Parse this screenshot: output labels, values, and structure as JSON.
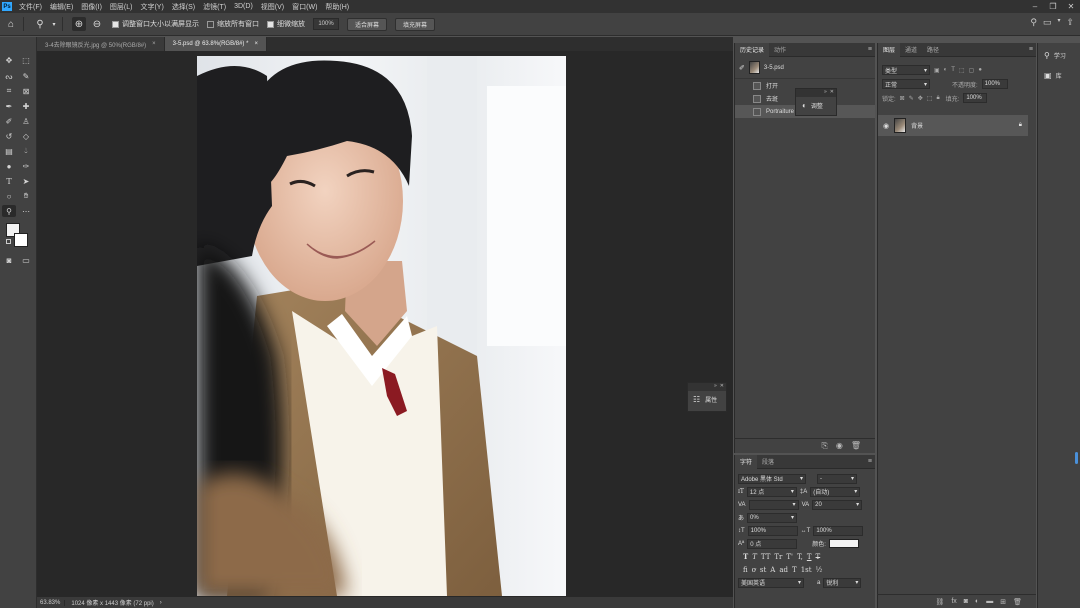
{
  "menubar": {
    "logo": "Ps",
    "items": [
      "文件(F)",
      "编辑(E)",
      "图像(I)",
      "图层(L)",
      "文字(Y)",
      "选择(S)",
      "滤镜(T)",
      "3D(D)",
      "视图(V)",
      "窗口(W)",
      "帮助(H)"
    ]
  },
  "options": {
    "resize_windows_label": "调整窗口大小以满屏显示",
    "zoom_all_label": "缩放所有窗口",
    "scrubby_label": "细微缩放",
    "zoom_value": "100%",
    "fit_screen_label": "适合屏幕",
    "fill_screen_label": "填充屏幕"
  },
  "tabs": [
    {
      "label": "3-4去除眼镜反光.jpg @ 50%(RGB/8#)",
      "close": "×"
    },
    {
      "label": "3-5.psd @ 63.8%(RGB/8#) *",
      "close": "×"
    }
  ],
  "status": {
    "zoom": "63.83%",
    "size": "1024 像素 x 1443 像素 (72 ppi)",
    "arrow": "›"
  },
  "properties_float": {
    "label": "属性"
  },
  "history": {
    "tabs": [
      "历史记录",
      "动作"
    ],
    "snapshot": "3-5.psd",
    "rows": [
      "打开",
      "去斑",
      "Portraiture"
    ]
  },
  "adjust_float": {
    "label": "调整"
  },
  "character": {
    "tabs": [
      "字符",
      "段落"
    ],
    "font_family": "Adobe 黑体 Std",
    "font_style": "-",
    "font_size": "12 点",
    "leading": "(自动)",
    "kerning": "",
    "tracking": "20",
    "scale_pct": "0%",
    "vscale": "100%",
    "hscale": "100%",
    "baseline": "0 点",
    "color_label": "颜色:",
    "glyphs": [
      "T",
      "T",
      "TT",
      "Tr",
      "T'",
      "T,",
      "T",
      "T"
    ],
    "opentype": [
      "fi",
      "ơ",
      "st",
      "A",
      "ad",
      "T",
      "1st",
      "½"
    ],
    "language": "美国英语",
    "aa_label": "a",
    "aa_value": "锐利"
  },
  "layers": {
    "tabs": [
      "图层",
      "通道",
      "路径"
    ],
    "filter_kind": "类型",
    "blend_mode": "正常",
    "opacity_label": "不透明度:",
    "opacity_value": "100%",
    "lock_label": "锁定:",
    "fill_label": "填充:",
    "fill_value": "100%",
    "layer_name": "背景"
  },
  "right_strip": {
    "learn": "学习",
    "library": "库"
  }
}
